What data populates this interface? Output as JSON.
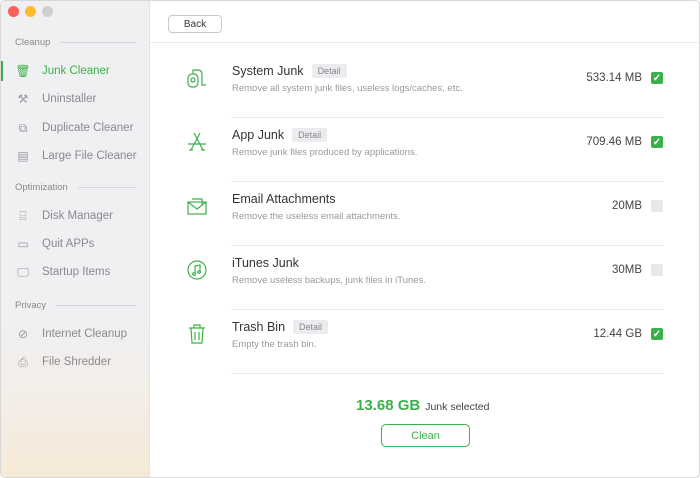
{
  "sidebar": {
    "sections": [
      {
        "label": "Cleanup"
      },
      {
        "label": "Optimization"
      },
      {
        "label": "Privacy"
      }
    ],
    "items": [
      {
        "label": "Junk Cleaner",
        "icon": "trash-icon",
        "active": true
      },
      {
        "label": "Uninstaller",
        "icon": "app-store-icon"
      },
      {
        "label": "Duplicate Cleaner",
        "icon": "duplicate-icon"
      },
      {
        "label": "Large File Cleaner",
        "icon": "file-icon"
      },
      {
        "label": "Disk Manager",
        "icon": "disk-icon"
      },
      {
        "label": "Quit APPs",
        "icon": "window-icon"
      },
      {
        "label": "Startup Items",
        "icon": "monitor-icon"
      },
      {
        "label": "Internet Cleanup",
        "icon": "compass-icon"
      },
      {
        "label": "File Shredder",
        "icon": "shredder-icon"
      }
    ]
  },
  "header": {
    "back_label": "Back"
  },
  "rows": [
    {
      "title": "System Junk",
      "detail": "Detail",
      "desc": "Remove all system junk files, useless logs/caches, etc.",
      "size": "533.14 MB",
      "checked": true,
      "icon": "vacuum-icon"
    },
    {
      "title": "App Junk",
      "detail": "Detail",
      "desc": "Remove junk files produced by applications.",
      "size": "709.46 MB",
      "checked": true,
      "icon": "app-store-icon"
    },
    {
      "title": "Email Attachments",
      "desc": "Remove the useless email attachments.",
      "size": "20MB",
      "checked": false,
      "icon": "email-icon"
    },
    {
      "title": "iTunes Junk",
      "desc": "Remove useless backups, junk files in iTunes.",
      "size": "30MB",
      "checked": false,
      "icon": "music-icon"
    },
    {
      "title": "Trash Bin",
      "detail": "Detail",
      "desc": "Empty the trash bin.",
      "size": "12.44 GB",
      "checked": true,
      "icon": "trash-icon"
    }
  ],
  "footer": {
    "total": "13.68 GB",
    "total_label": "Junk selected",
    "clean_label": "Clean"
  },
  "colors": {
    "accent": "#3cb04a"
  }
}
